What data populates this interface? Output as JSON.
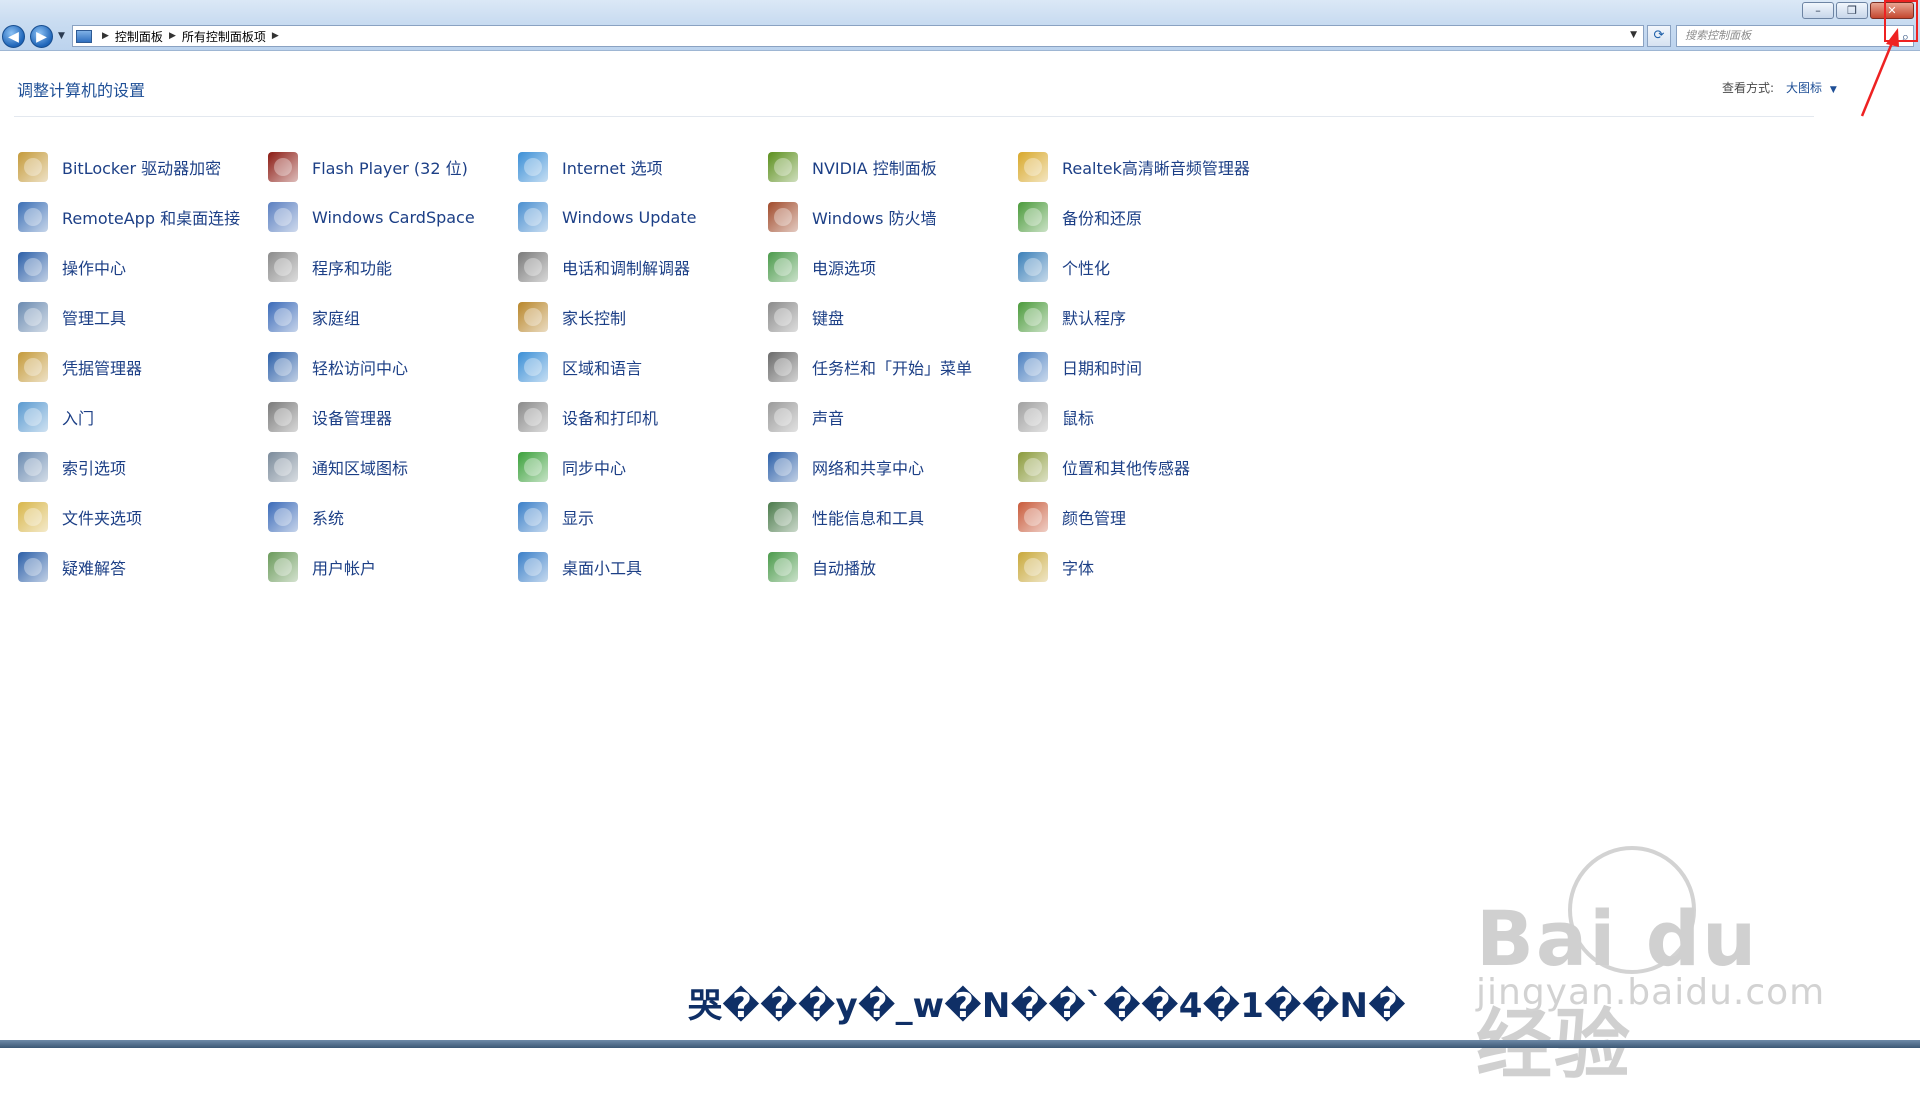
{
  "nav": {
    "breadcrumb": [
      "控制面板",
      "所有控制面板项"
    ],
    "search_placeholder": "搜索控制面板"
  },
  "header": {
    "title": "调整计算机的设置",
    "view_label": "查看方式:",
    "view_value": "大图标"
  },
  "items": [
    {
      "label": "BitLocker 驱动器加密",
      "icon": "lock-icon",
      "color": "#c49a3a"
    },
    {
      "label": "Flash Player (32 位)",
      "icon": "flash-icon",
      "color": "#8b1a12"
    },
    {
      "label": "Internet 选项",
      "icon": "globe-icon",
      "color": "#3b8fd6"
    },
    {
      "label": "NVIDIA 控制面板",
      "icon": "nvidia-icon",
      "color": "#5b8f1c"
    },
    {
      "label": "Realtek高清晰音频管理器",
      "icon": "speaker-icon",
      "color": "#d8a82a"
    },
    {
      "label": "RemoteApp 和桌面连接",
      "icon": "remote-icon",
      "color": "#3b6fb5"
    },
    {
      "label": "Windows CardSpace",
      "icon": "card-icon",
      "color": "#5a7fc0"
    },
    {
      "label": "Windows Update",
      "icon": "update-icon",
      "color": "#4a8fd0"
    },
    {
      "label": "Windows 防火墙",
      "icon": "firewall-icon",
      "color": "#a04a2a"
    },
    {
      "label": "备份和还原",
      "icon": "backup-icon",
      "color": "#4a9a3a"
    },
    {
      "label": "操作中心",
      "icon": "flag-icon",
      "color": "#2b5fa8"
    },
    {
      "label": "程序和功能",
      "icon": "programs-icon",
      "color": "#8a8a8a"
    },
    {
      "label": "电话和调制解调器",
      "icon": "phone-icon",
      "color": "#7a7a7a"
    },
    {
      "label": "电源选项",
      "icon": "power-icon",
      "color": "#4a9a4a"
    },
    {
      "label": "个性化",
      "icon": "personalize-icon",
      "color": "#3a7fb8"
    },
    {
      "label": "管理工具",
      "icon": "tools-icon",
      "color": "#6a8ab0"
    },
    {
      "label": "家庭组",
      "icon": "homegroup-icon",
      "color": "#3a6ab8"
    },
    {
      "label": "家长控制",
      "icon": "parental-icon",
      "color": "#b8862a"
    },
    {
      "label": "键盘",
      "icon": "keyboard-icon",
      "color": "#8a8a8a"
    },
    {
      "label": "默认程序",
      "icon": "default-programs-icon",
      "color": "#4a9a3a"
    },
    {
      "label": "凭据管理器",
      "icon": "credential-icon",
      "color": "#c49a3a"
    },
    {
      "label": "轻松访问中心",
      "icon": "accessibility-icon",
      "color": "#2b5fa8"
    },
    {
      "label": "区域和语言",
      "icon": "region-icon",
      "color": "#3b8fd6"
    },
    {
      "label": "任务栏和「开始」菜单",
      "icon": "taskbar-icon",
      "color": "#6a6a6a"
    },
    {
      "label": "日期和时间",
      "icon": "calendar-icon",
      "color": "#4a7fc0"
    },
    {
      "label": "入门",
      "icon": "getting-started-icon",
      "color": "#5a9ad0"
    },
    {
      "label": "设备管理器",
      "icon": "device-manager-icon",
      "color": "#7a7a7a"
    },
    {
      "label": "设备和打印机",
      "icon": "printer-icon",
      "color": "#8a8a8a"
    },
    {
      "label": "声音",
      "icon": "sound-icon",
      "color": "#9a9a9a"
    },
    {
      "label": "鼠标",
      "icon": "mouse-icon",
      "color": "#a0a0a0"
    },
    {
      "label": "索引选项",
      "icon": "index-icon",
      "color": "#6a8ab0"
    },
    {
      "label": "通知区域图标",
      "icon": "notification-icon",
      "color": "#7a8a9a"
    },
    {
      "label": "同步中心",
      "icon": "sync-icon",
      "color": "#3aa03a"
    },
    {
      "label": "网络和共享中心",
      "icon": "network-icon",
      "color": "#2b5fa8"
    },
    {
      "label": "位置和其他传感器",
      "icon": "sensor-icon",
      "color": "#8a9a3a"
    },
    {
      "label": "文件夹选项",
      "icon": "folder-icon",
      "color": "#d8b64a"
    },
    {
      "label": "系统",
      "icon": "system-icon",
      "color": "#3a6ab8"
    },
    {
      "label": "显示",
      "icon": "display-icon",
      "color": "#3a7fc8"
    },
    {
      "label": "性能信息和工具",
      "icon": "performance-icon",
      "color": "#4a7a4a"
    },
    {
      "label": "颜色管理",
      "icon": "color-icon",
      "color": "#c85a3a"
    },
    {
      "label": "疑难解答",
      "icon": "troubleshoot-icon",
      "color": "#2b5fa8"
    },
    {
      "label": "用户帐户",
      "icon": "user-icon",
      "color": "#6a9a5a"
    },
    {
      "label": "桌面小工具",
      "icon": "gadget-icon",
      "color": "#3a7fc8"
    },
    {
      "label": "自动播放",
      "icon": "autoplay-icon",
      "color": "#4a9a4a"
    },
    {
      "label": "字体",
      "icon": "font-icon",
      "color": "#c8a83a"
    }
  ],
  "watermark": {
    "logo_text": "Bai du 经验",
    "url_text": "jingyan.baidu.com"
  },
  "banner_text": "哭���y�_w�N��`��4�1��N�"
}
